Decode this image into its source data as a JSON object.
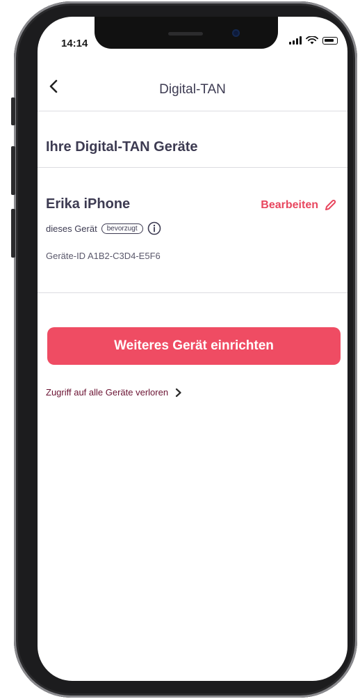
{
  "status_bar": {
    "time": "14:14"
  },
  "nav": {
    "title": "Digital-TAN"
  },
  "section": {
    "title": "Ihre Digital-TAN Geräte"
  },
  "device": {
    "name": "Erika iPhone",
    "edit_label": "Bearbeiten",
    "meta_label": "dieses Gerät",
    "badge": "bevorzugt",
    "id_text": "Geräte-ID A1B2-C3D4-E5F6"
  },
  "actions": {
    "add_device": "Weiteres Gerät einrichten",
    "lost_access": "Zugriff auf alle Geräte verloren"
  },
  "colors": {
    "accent": "#ef4c63",
    "text": "#3d3b52",
    "link": "#6a1232"
  }
}
